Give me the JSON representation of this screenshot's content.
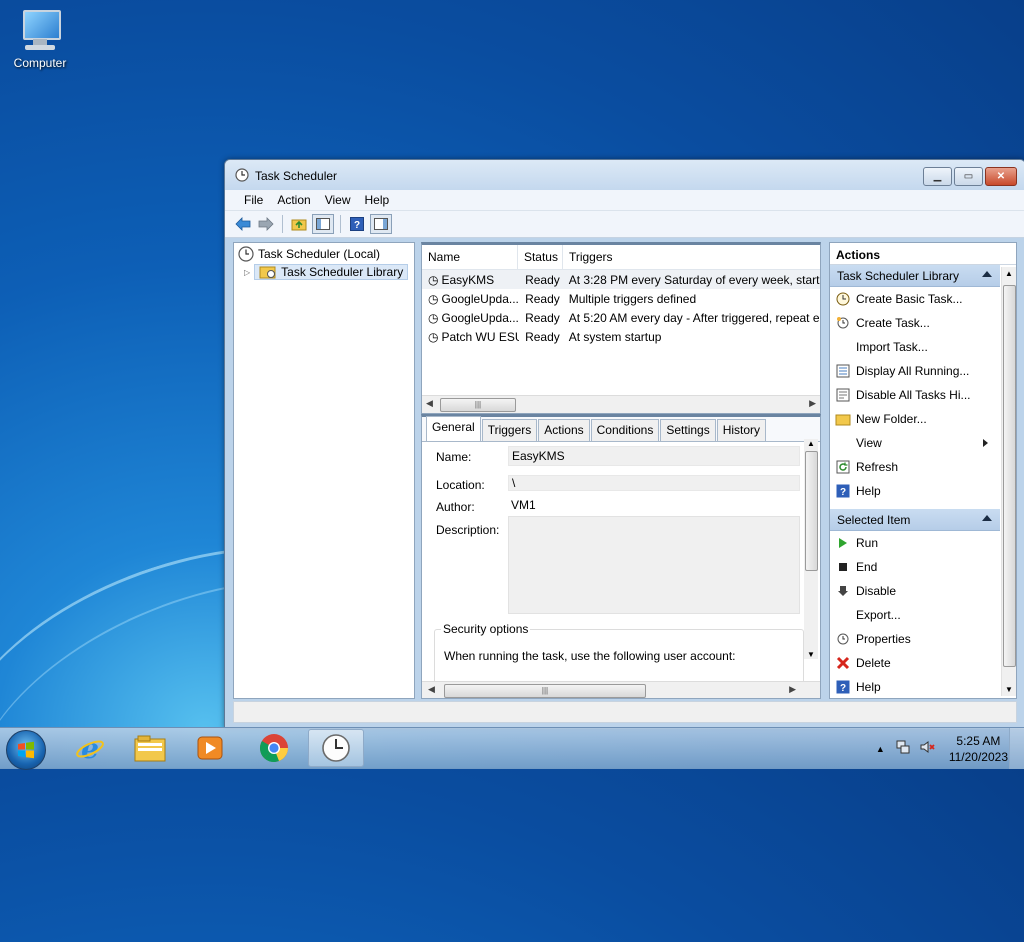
{
  "desktop": {
    "icon_label": "Computer"
  },
  "window": {
    "title": "Task Scheduler",
    "menu": [
      "File",
      "Action",
      "View",
      "Help"
    ]
  },
  "tree": {
    "root": "Task Scheduler (Local)",
    "library": "Task Scheduler Library"
  },
  "task_list": {
    "columns": [
      "Name",
      "Status",
      "Triggers"
    ],
    "rows": [
      {
        "name": "EasyKMS",
        "status": "Ready",
        "triggers": "At 3:28 PM every Saturday of every week, starti"
      },
      {
        "name": "GoogleUpda...",
        "status": "Ready",
        "triggers": "Multiple triggers defined"
      },
      {
        "name": "GoogleUpda...",
        "status": "Ready",
        "triggers": "At 5:20 AM every day - After triggered, repeat e"
      },
      {
        "name": "Patch WU ESU",
        "status": "Ready",
        "triggers": "At system startup"
      }
    ],
    "selected_index": 0
  },
  "details": {
    "tabs": [
      "General",
      "Triggers",
      "Actions",
      "Conditions",
      "Settings",
      "History"
    ],
    "active_tab": "General",
    "name_label": "Name:",
    "name_value": "EasyKMS",
    "location_label": "Location:",
    "location_value": "\\",
    "author_label": "Author:",
    "author_value": "VM1",
    "description_label": "Description:",
    "security_title": "Security options",
    "security_text": "When running the task, use the following user account:"
  },
  "actions_pane": {
    "header": "Actions",
    "section1": "Task Scheduler Library",
    "section1_items": [
      {
        "label": "Create Basic Task...",
        "icon": "wizard-clock-icon"
      },
      {
        "label": "Create Task...",
        "icon": "task-clock-icon"
      },
      {
        "label": "Import Task...",
        "icon": ""
      },
      {
        "label": "Display All Running...",
        "icon": "running-tasks-icon"
      },
      {
        "label": "Disable All Tasks Hi...",
        "icon": "history-icon"
      },
      {
        "label": "New Folder...",
        "icon": "folder-icon"
      },
      {
        "label": "View",
        "icon": ""
      },
      {
        "label": "Refresh",
        "icon": "refresh-icon"
      },
      {
        "label": "Help",
        "icon": "help-icon"
      }
    ],
    "section2": "Selected Item",
    "section2_items": [
      {
        "label": "Run",
        "icon": "run-icon"
      },
      {
        "label": "End",
        "icon": "end-icon"
      },
      {
        "label": "Disable",
        "icon": "disable-icon"
      },
      {
        "label": "Export...",
        "icon": ""
      },
      {
        "label": "Properties",
        "icon": "properties-icon"
      },
      {
        "label": "Delete",
        "icon": "delete-icon"
      },
      {
        "label": "Help",
        "icon": "help-icon"
      }
    ]
  },
  "taskbar": {
    "time": "5:25 AM",
    "date": "11/20/2023",
    "apps": [
      "internet-explorer-icon",
      "file-explorer-icon",
      "media-player-icon",
      "chrome-icon",
      "task-scheduler-icon"
    ]
  }
}
